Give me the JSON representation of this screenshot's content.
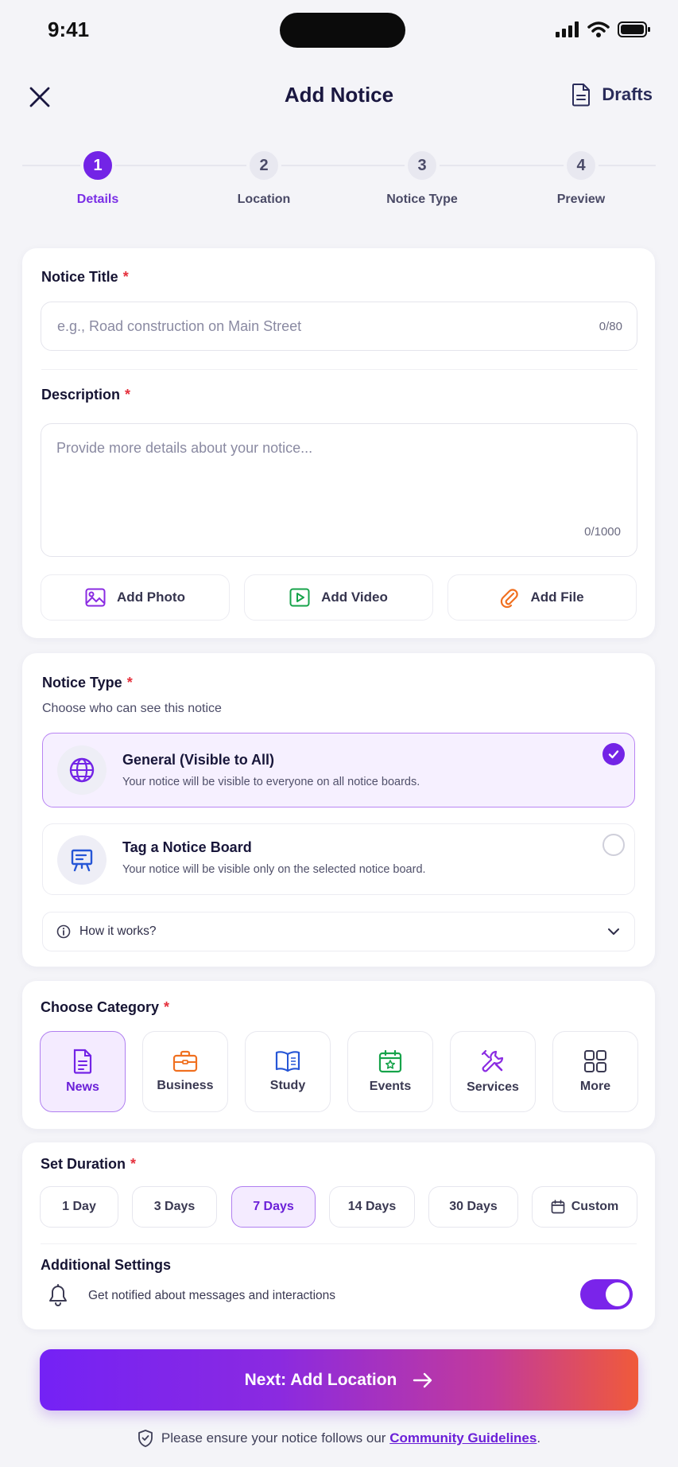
{
  "status_bar": {
    "time": "9:41"
  },
  "header": {
    "title": "Add Notice",
    "drafts_label": "Drafts"
  },
  "steps": [
    {
      "number": "1",
      "label": "Details"
    },
    {
      "number": "2",
      "label": "Location"
    },
    {
      "number": "3",
      "label": "Notice Type"
    },
    {
      "number": "4",
      "label": "Preview"
    }
  ],
  "details": {
    "title_label": "Notice Title",
    "title_placeholder": "e.g., Road construction on Main Street",
    "title_counter": "0/80",
    "description_label": "Description",
    "description_placeholder": "Provide more details about your notice...",
    "description_counter": "0/1000",
    "add_photo": "Add Photo",
    "add_video": "Add Video",
    "add_file": "Add File",
    "required_mark": "*"
  },
  "notice_type": {
    "label": "Notice Type",
    "subtitle": "Choose who can see this notice",
    "options": [
      {
        "title": "General (Visible to All)",
        "desc": "Your notice will be visible to everyone on all notice boards.",
        "selected": true
      },
      {
        "title": "Tag a Notice Board",
        "desc": "Your notice will be visible only on the selected notice board.",
        "selected": false
      }
    ],
    "how_it_works": "How it works?"
  },
  "category": {
    "label": "Choose Category",
    "items": [
      "News",
      "Business",
      "Study",
      "Events",
      "Services",
      "More"
    ],
    "selected": "News"
  },
  "duration": {
    "label": "Set Duration",
    "options": [
      "1 Day",
      "3 Days",
      "7 Days",
      "14 Days",
      "30 Days",
      "Custom"
    ],
    "selected": "7 Days"
  },
  "additional": {
    "label": "Additional Settings",
    "notify_text": "Get notified about messages and interactions",
    "notify_enabled": true
  },
  "next_button": "Next: Add Location",
  "footer": {
    "text": "Please ensure your notice follows our",
    "link": "Community Guidelines",
    "period": "."
  },
  "colors": {
    "accent": "#7324e6",
    "required": "#e5303c",
    "gradient_end": "#f05a3a"
  }
}
